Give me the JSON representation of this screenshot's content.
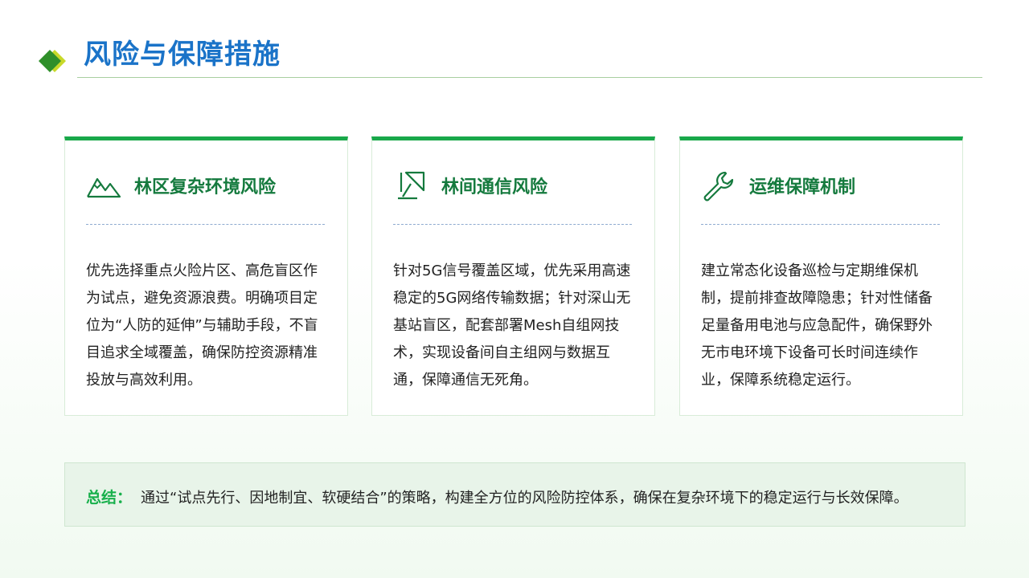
{
  "header": {
    "title": "风险与保障措施"
  },
  "cards": [
    {
      "icon": "mountain-icon",
      "title": "林区复杂环境风险",
      "body": "优先选择重点火险片区、高危盲区作为试点，避免资源浪费。明确项目定位为“人防的延伸”与辅助手段，不盲目追求全域覆盖，确保防控资源精准投放与高效利用。"
    },
    {
      "icon": "satellite-dish-icon",
      "title": "林间通信风险",
      "body": "针对5G信号覆盖区域，优先采用高速稳定的5G网络传输数据；针对深山无基站盲区，配套部署Mesh自组网技术，实现设备间自主组网与数据互通，保障通信无死角。"
    },
    {
      "icon": "wrench-icon",
      "title": "运维保障机制",
      "body": "建立常态化设备巡检与定期维保机制，提前排查故障隐患；针对性储备足量备用电池与应急配件，确保野外无市电环境下设备可长时间连续作业，保障系统稳定运行。"
    }
  ],
  "summary": {
    "label": "总结：",
    "text": "通过“试点先行、因地制宜、软硬结合”的策略，构建全方位的风险防控体系，确保在复杂环境下的稳定运行与长效保障。"
  },
  "colors": {
    "title": "#1a73c8",
    "accent_green": "#19a84a",
    "card_title": "#157a3e",
    "summary_bg": "#e8f4e9"
  }
}
